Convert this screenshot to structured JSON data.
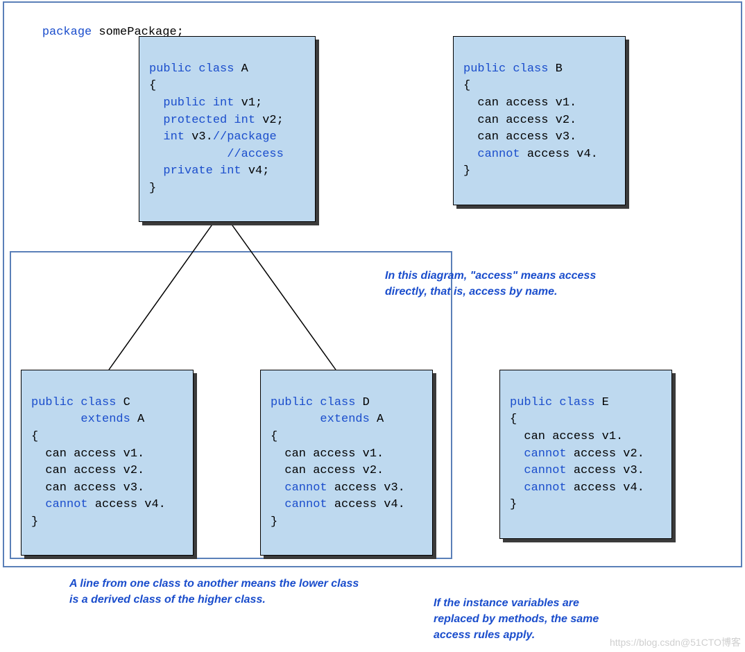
{
  "package_decl": {
    "kw_package": "package",
    "name": " somePackage;"
  },
  "classA": {
    "l1_kw": "public class",
    "l1_txt": " A",
    "l2": "{",
    "l3_kw": "  public int",
    "l3_txt": " v1;",
    "l4_kw": "  protected int",
    "l4_txt": " v2;",
    "l5_kw": "  int",
    "l5_txta": " v3.",
    "l5_cmt": "//package",
    "l6_cmt": "           //access",
    "l7_kw": "  private int",
    "l7_txt": " v4;",
    "l8": "}"
  },
  "classB": {
    "l1_kw": "public class",
    "l1_txt": " B",
    "l2": "{",
    "l3": "  can access v1.",
    "l4": "  can access v2.",
    "l5": "  can access v3.",
    "l6_kw": "  cannot",
    "l6_txt": " access v4.",
    "l7": "}"
  },
  "classC": {
    "l1_kw": "public class",
    "l1_txt": " C",
    "l2_kw": "       extends",
    "l2_txt": " A",
    "l3": "{",
    "l4": "  can access v1.",
    "l5": "  can access v2.",
    "l6": "  can access v3.",
    "l7_kw": "  cannot",
    "l7_txt": " access v4.",
    "l8": "}"
  },
  "classD": {
    "l1_kw": "public class",
    "l1_txt": " D",
    "l2_kw": "       extends",
    "l2_txt": " A",
    "l3": "{",
    "l4": "  can access v1.",
    "l5": "  can access v2.",
    "l6_kw": "  cannot",
    "l6_txt": " access v3.",
    "l7_kw": "  cannot",
    "l7_txt": " access v4.",
    "l8": "}"
  },
  "classE": {
    "l1_kw": "public class",
    "l1_txt": " E",
    "l2": "{",
    "l3": "  can access v1.",
    "l4_kw": "  cannot",
    "l4_txt": " access v2.",
    "l5_kw": "  cannot",
    "l5_txt": " access v3.",
    "l6_kw": "  cannot",
    "l6_txt": " access v4.",
    "l7": "}"
  },
  "notes": {
    "access_meaning": "In this diagram, \"access\" means access\ndirectly, that is, access by name.",
    "line_meaning": "A line from one class to another means the lower class\nis a derived class of the higher class.",
    "methods_meaning": "If the instance variables are\nreplaced by methods, the same\naccess rules apply."
  },
  "watermark": "https://blog.csdn@51CTO博客"
}
